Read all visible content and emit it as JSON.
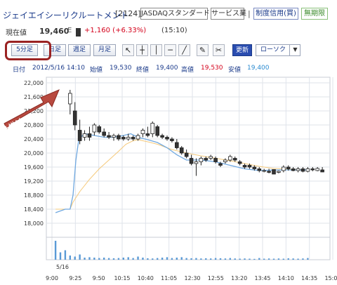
{
  "header": {
    "company": "ジェイエイシーリクルートメント",
    "code": "[2124]",
    "market": "JASDAQスタンダード",
    "industry": "サービス業",
    "separator": "|",
    "credit": "制度信用(買)",
    "limit": "無期限"
  },
  "price": {
    "label": "現在値",
    "value": "19,460",
    "flag": "E",
    "change": "+1,160 (+6.33%)",
    "time": "(15:10)"
  },
  "toolbar": {
    "range_buttons": [
      "5分足",
      "日足",
      "週足",
      "月足"
    ],
    "tools": [
      {
        "name": "cursor-icon",
        "glyph": "↖"
      },
      {
        "name": "crosshair-icon",
        "glyph": "┼"
      },
      {
        "name": "vertical-line-icon",
        "glyph": "│"
      },
      {
        "name": "horizontal-line-icon",
        "glyph": "─"
      },
      {
        "name": "trend-line-icon",
        "glyph": "╱"
      },
      {
        "name": "eraser-icon",
        "glyph": "✎"
      },
      {
        "name": "settings-icon",
        "glyph": "✂"
      }
    ],
    "update_label": "更新",
    "chart_type": "ローソク",
    "dropdown_glyph": "▼"
  },
  "info": {
    "date_label": "日付",
    "datetime": "2012/5/16 14:10",
    "open_label": "始値",
    "open": "19,530",
    "close_label": "終値",
    "close": "19,400",
    "high_label": "高値",
    "high": "19,530",
    "low_label": "安値",
    "low": "19,400"
  },
  "annotation": {
    "text": "仕掛け",
    "color": "#b84a40"
  },
  "colors": {
    "ma_short": "#6fa8e0",
    "ma_long": "#f5c97a",
    "volume": "#5a9ad6",
    "candle_border": "#222222",
    "price_up": "#d4001a",
    "highlight_box": "#9a2222"
  },
  "chart_data": {
    "type": "candlestick",
    "ylim": [
      17600,
      22000
    ],
    "yticks": [
      22000,
      21600,
      21200,
      20800,
      20400,
      20000,
      19600,
      19200,
      18800,
      18400,
      18000
    ],
    "ytick_labels": [
      "22,000",
      "21,600",
      "21,200",
      "20,800",
      "20,400",
      "20,000",
      "19,600",
      "19,200",
      "18,800",
      "18,400",
      "18,000"
    ],
    "xtick_labels": [
      "9:00",
      "9:25",
      "9:50",
      "10:15",
      "10:40",
      "11:05",
      "12:30",
      "12:55",
      "13:20",
      "13:45",
      "14:10",
      "14:35",
      "15:00"
    ],
    "date_label": "5/16",
    "candles": [
      {
        "t": "9:20",
        "o": 21400,
        "h": 21800,
        "l": 21100,
        "c": 21700
      },
      {
        "t": "9:25",
        "o": 21200,
        "h": 21450,
        "l": 20650,
        "c": 20800
      },
      {
        "t": "9:30",
        "o": 20650,
        "h": 20950,
        "l": 20250,
        "c": 20350
      },
      {
        "t": "9:35",
        "o": 20450,
        "h": 20650,
        "l": 20350,
        "c": 20550
      },
      {
        "t": "9:40",
        "o": 20550,
        "h": 20750,
        "l": 20350,
        "c": 20450
      },
      {
        "t": "9:45",
        "o": 20600,
        "h": 20850,
        "l": 20500,
        "c": 20800
      },
      {
        "t": "9:50",
        "o": 20750,
        "h": 20800,
        "l": 20550,
        "c": 20600
      },
      {
        "t": "9:55",
        "o": 20600,
        "h": 20700,
        "l": 20450,
        "c": 20500
      },
      {
        "t": "10:00",
        "o": 20500,
        "h": 20600,
        "l": 20400,
        "c": 20450
      },
      {
        "t": "10:05",
        "o": 20450,
        "h": 20550,
        "l": 20350,
        "c": 20500
      },
      {
        "t": "10:10",
        "o": 20500,
        "h": 20550,
        "l": 20350,
        "c": 20400
      },
      {
        "t": "10:15",
        "o": 20450,
        "h": 20500,
        "l": 20350,
        "c": 20400
      },
      {
        "t": "10:20",
        "o": 20400,
        "h": 20550,
        "l": 20350,
        "c": 20450
      },
      {
        "t": "10:25",
        "o": 20450,
        "h": 20500,
        "l": 20350,
        "c": 20400
      },
      {
        "t": "10:30",
        "o": 20400,
        "h": 20550,
        "l": 20350,
        "c": 20500
      },
      {
        "t": "10:35",
        "o": 20550,
        "h": 20700,
        "l": 20450,
        "c": 20650
      },
      {
        "t": "10:40",
        "o": 20550,
        "h": 20750,
        "l": 20450,
        "c": 20500
      },
      {
        "t": "10:45",
        "o": 20550,
        "h": 20900,
        "l": 20450,
        "c": 20850
      },
      {
        "t": "10:50",
        "o": 20750,
        "h": 20800,
        "l": 20450,
        "c": 20500
      },
      {
        "t": "10:55",
        "o": 20500,
        "h": 20550,
        "l": 20400,
        "c": 20450
      },
      {
        "t": "11:00",
        "o": 20450,
        "h": 20500,
        "l": 20350,
        "c": 20400
      },
      {
        "t": "11:05",
        "o": 20400,
        "h": 20450,
        "l": 20300,
        "c": 20350
      },
      {
        "t": "12:30",
        "o": 20300,
        "h": 20400,
        "l": 20100,
        "c": 20150
      },
      {
        "t": "12:35",
        "o": 20150,
        "h": 20200,
        "l": 19950,
        "c": 20000
      },
      {
        "t": "12:40",
        "o": 20000,
        "h": 20100,
        "l": 19850,
        "c": 19900
      },
      {
        "t": "12:45",
        "o": 19850,
        "h": 19950,
        "l": 19650,
        "c": 19700
      },
      {
        "t": "12:50",
        "o": 19700,
        "h": 19850,
        "l": 19350,
        "c": 19750
      },
      {
        "t": "12:55",
        "o": 19750,
        "h": 19900,
        "l": 19650,
        "c": 19850
      },
      {
        "t": "13:00",
        "o": 19850,
        "h": 19900,
        "l": 19750,
        "c": 19800
      },
      {
        "t": "13:05",
        "o": 19850,
        "h": 19950,
        "l": 19800,
        "c": 19900
      },
      {
        "t": "13:10",
        "o": 19850,
        "h": 19900,
        "l": 19700,
        "c": 19750
      },
      {
        "t": "13:15",
        "o": 19700,
        "h": 19750,
        "l": 19600,
        "c": 19650
      },
      {
        "t": "13:20",
        "o": 19750,
        "h": 19850,
        "l": 19700,
        "c": 19800
      },
      {
        "t": "13:25",
        "o": 19800,
        "h": 19950,
        "l": 19750,
        "c": 19900
      },
      {
        "t": "13:30",
        "o": 19850,
        "h": 19900,
        "l": 19750,
        "c": 19800
      },
      {
        "t": "13:35",
        "o": 19750,
        "h": 19800,
        "l": 19650,
        "c": 19700
      },
      {
        "t": "13:40",
        "o": 19650,
        "h": 19700,
        "l": 19550,
        "c": 19600
      },
      {
        "t": "13:45",
        "o": 19650,
        "h": 19700,
        "l": 19550,
        "c": 19600
      },
      {
        "t": "13:50",
        "o": 19600,
        "h": 19650,
        "l": 19500,
        "c": 19550
      },
      {
        "t": "13:55",
        "o": 19550,
        "h": 19600,
        "l": 19450,
        "c": 19500
      },
      {
        "t": "14:00",
        "o": 19500,
        "h": 19550,
        "l": 19450,
        "c": 19500
      },
      {
        "t": "14:05",
        "o": 19480,
        "h": 19550,
        "l": 19420,
        "c": 19450
      },
      {
        "t": "14:10",
        "o": 19530,
        "h": 19530,
        "l": 19400,
        "c": 19400
      },
      {
        "t": "14:15",
        "o": 19450,
        "h": 19500,
        "l": 19420,
        "c": 19480
      },
      {
        "t": "14:20",
        "o": 19500,
        "h": 19650,
        "l": 19450,
        "c": 19600
      },
      {
        "t": "14:25",
        "o": 19600,
        "h": 19650,
        "l": 19500,
        "c": 19550
      },
      {
        "t": "14:30",
        "o": 19550,
        "h": 19600,
        "l": 19480,
        "c": 19500
      },
      {
        "t": "14:35",
        "o": 19500,
        "h": 19600,
        "l": 19450,
        "c": 19550
      },
      {
        "t": "14:40",
        "o": 19550,
        "h": 19600,
        "l": 19450,
        "c": 19480
      },
      {
        "t": "14:45",
        "o": 19480,
        "h": 19600,
        "l": 19450,
        "c": 19550
      },
      {
        "t": "14:50",
        "o": 19550,
        "h": 19600,
        "l": 19480,
        "c": 19520
      },
      {
        "t": "14:55",
        "o": 19500,
        "h": 19600,
        "l": 19480,
        "c": 19560
      },
      {
        "t": "15:00",
        "o": 19520,
        "h": 19600,
        "l": 19460,
        "c": 19460
      }
    ],
    "ma_short": [
      [
        0,
        18300
      ],
      [
        2,
        18400
      ],
      [
        3,
        18400
      ],
      [
        3.6,
        18800
      ],
      [
        4.2,
        19800
      ],
      [
        4.8,
        20400
      ],
      [
        6,
        20550
      ],
      [
        8,
        20500
      ],
      [
        10,
        20450
      ],
      [
        12,
        20450
      ],
      [
        14,
        20500
      ],
      [
        15.5,
        20550
      ],
      [
        17,
        20450
      ],
      [
        19,
        20380
      ],
      [
        21,
        20300
      ],
      [
        23,
        20150
      ],
      [
        25,
        19950
      ],
      [
        27,
        19800
      ],
      [
        30,
        19800
      ],
      [
        33,
        19750
      ],
      [
        36,
        19650
      ],
      [
        39,
        19550
      ],
      [
        42,
        19500
      ],
      [
        46,
        19520
      ],
      [
        49,
        19520
      ],
      [
        52,
        19520
      ]
    ],
    "ma_long": [
      [
        0,
        18400
      ],
      [
        2,
        18400
      ],
      [
        3,
        18400
      ],
      [
        3.6,
        18600
      ],
      [
        5,
        18900
      ],
      [
        7,
        19250
      ],
      [
        9,
        19550
      ],
      [
        11,
        19800
      ],
      [
        13,
        20050
      ],
      [
        14.5,
        20250
      ],
      [
        16,
        20350
      ],
      [
        17,
        20380
      ],
      [
        19,
        20320
      ],
      [
        21,
        20250
      ],
      [
        24,
        20100
      ],
      [
        27,
        20000
      ],
      [
        30,
        19920
      ],
      [
        33,
        19850
      ],
      [
        36,
        19780
      ],
      [
        39,
        19700
      ],
      [
        42,
        19620
      ],
      [
        45,
        19560
      ],
      [
        48,
        19540
      ],
      [
        52,
        19520
      ]
    ],
    "volume": [
      0.9,
      0.35,
      0.45,
      0.2,
      0.15,
      0.25,
      0.1,
      0.12,
      0.1,
      0.08,
      0.1,
      0.08,
      0.07,
      0.08,
      0.1,
      0.12,
      0.08,
      0.15,
      0.1,
      0.07,
      0.06,
      0.08,
      0.1,
      0.12,
      0.08,
      0.1,
      0.12,
      0.08,
      0.07,
      0.08,
      0.06,
      0.07,
      0.06,
      0.08,
      0.07,
      0.06,
      0.08,
      0.06,
      0.05,
      0.06,
      0.05,
      0.04,
      0.08,
      0.05,
      0.06,
      0.05,
      0.06,
      0.05,
      0.07,
      0.06,
      0.05,
      0.06,
      0.08
    ]
  }
}
